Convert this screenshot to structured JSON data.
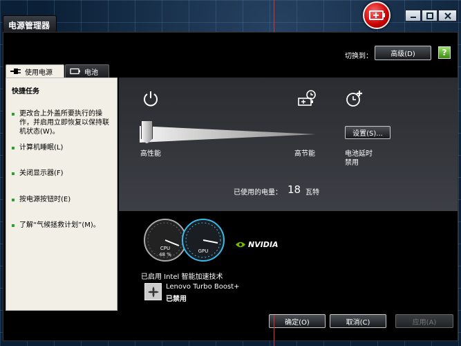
{
  "window": {
    "title": "电源管理器",
    "controls": [
      "minimize-icon",
      "maximize-icon",
      "close-icon"
    ]
  },
  "header": {
    "switch_label": "切换到：",
    "advanced_button": "高级(D)",
    "help_icon": "?"
  },
  "tabs": [
    {
      "label": "使用电源",
      "icon": "power-plug-icon",
      "active": true
    },
    {
      "label": "电池",
      "icon": "battery-icon",
      "active": false
    }
  ],
  "quick_tasks": {
    "title": "快捷任务",
    "items": [
      {
        "label": "更改合上外盖所要执行的操作，并启用立即恢复以保持联机状态(W)。"
      },
      {
        "label": "计算机睡眠(L)"
      },
      {
        "label": "关闭显示器(F)"
      },
      {
        "label": "按电源按钮时(E)"
      },
      {
        "label": "了解“气候拯救计划”(M)。"
      }
    ]
  },
  "power_plan": {
    "high_performance_label": "高性能",
    "power_saver_label": "高节能",
    "battery_delay_label": "电池延时",
    "battery_delay_status": "禁用",
    "settings_button": "设置(S)...",
    "slider_position": 0,
    "used_power_label": "已使用的电量：",
    "used_power_value": "18",
    "used_power_unit": "瓦特"
  },
  "gauges": {
    "cpu_label": "CPU",
    "cpu_percent": "48 %",
    "gpu_label": "GPU",
    "nvidia_label": "NVIDIA"
  },
  "turbo": {
    "intel_label": "已启用 Intel 智能加速技术",
    "name": "Lenovo Turbo Boost+",
    "status": "已禁用"
  },
  "footer": {
    "ok_button": "确定(O)",
    "cancel_button": "取消(C)",
    "apply_button": "应用(A)"
  },
  "colors": {
    "bullet": "#27a12f",
    "app_icon": "#c80000",
    "gauge_accent": "#3ab8e8"
  }
}
